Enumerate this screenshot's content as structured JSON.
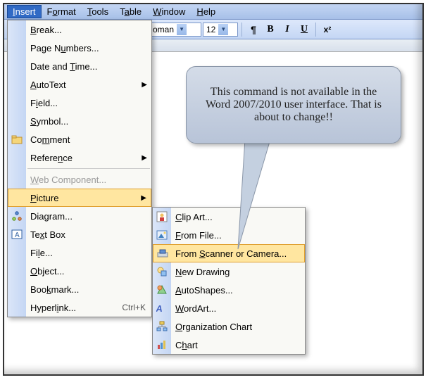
{
  "menubar": {
    "items": [
      {
        "label": "Insert",
        "active": true
      },
      {
        "label": "Format"
      },
      {
        "label": "Tools"
      },
      {
        "label": "Table"
      },
      {
        "label": "Window"
      },
      {
        "label": "Help"
      }
    ]
  },
  "toolbar": {
    "font_name_suffix": "oman",
    "font_size": "12",
    "pilcrow": "¶",
    "bold": "B",
    "italic": "I",
    "underline": "U",
    "superscript": "x²"
  },
  "insert_menu": {
    "items": [
      {
        "label": "Break...",
        "icon": ""
      },
      {
        "label": "Page Numbers...",
        "icon": ""
      },
      {
        "label": "Date and Time...",
        "icon": ""
      },
      {
        "label": "AutoText",
        "icon": "",
        "submenu": true
      },
      {
        "label": "Field...",
        "icon": ""
      },
      {
        "label": "Symbol...",
        "icon": ""
      },
      {
        "label": "Comment",
        "icon": "folder"
      },
      {
        "label": "Reference",
        "icon": "",
        "submenu": true
      },
      {
        "sep": true
      },
      {
        "label": "Web Component...",
        "icon": "",
        "disabled": true
      },
      {
        "label": "Picture",
        "icon": "",
        "submenu": true,
        "highlighted": true
      },
      {
        "label": "Diagram...",
        "icon": "diagram"
      },
      {
        "label": "Text Box",
        "icon": "textbox"
      },
      {
        "label": "File...",
        "icon": ""
      },
      {
        "label": "Object...",
        "icon": ""
      },
      {
        "label": "Bookmark...",
        "icon": ""
      },
      {
        "label": "Hyperlink...",
        "icon": "",
        "accel": "Ctrl+K"
      }
    ]
  },
  "picture_submenu": {
    "items": [
      {
        "label": "Clip Art...",
        "icon": "clipart"
      },
      {
        "label": "From File...",
        "icon": "fromfile"
      },
      {
        "label": "From Scanner or Camera...",
        "icon": "scanner",
        "highlighted": true
      },
      {
        "label": "New Drawing",
        "icon": "drawing"
      },
      {
        "label": "AutoShapes...",
        "icon": "shapes"
      },
      {
        "label": "WordArt...",
        "icon": "wordart"
      },
      {
        "label": "Organization Chart",
        "icon": "orgchart"
      },
      {
        "label": "Chart",
        "icon": "chart"
      }
    ]
  },
  "callout": {
    "text": "This command is not available in the Word 2007/2010 user interface.  That is about to change!!"
  }
}
